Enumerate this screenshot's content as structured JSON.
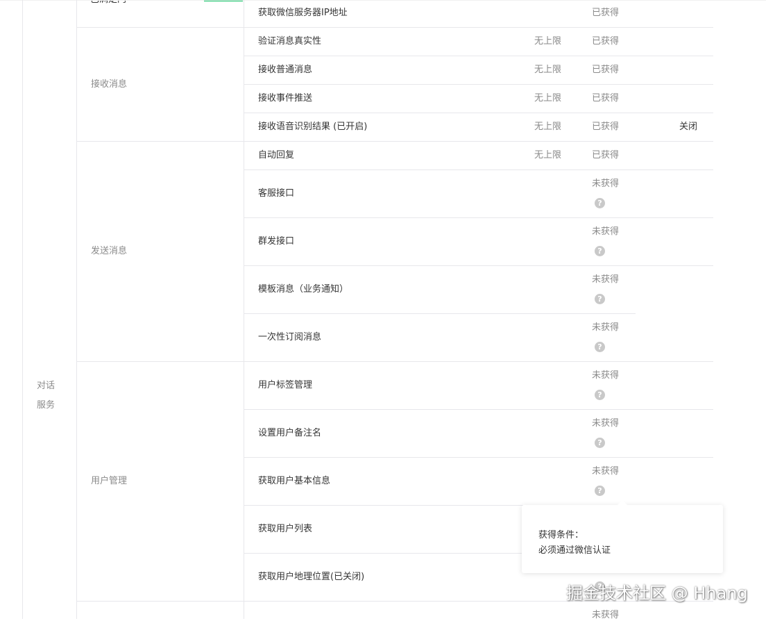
{
  "top_partial_label": "已满足门",
  "category": {
    "line1": "对话",
    "line2": "服务"
  },
  "groups": [
    {
      "label": "接收消息"
    },
    {
      "label": "发送消息"
    },
    {
      "label": "用户管理"
    }
  ],
  "rows": [
    {
      "name": "获取微信服务器IP地址",
      "limit": "",
      "status": "已获得",
      "action": ""
    },
    {
      "name": "验证消息真实性",
      "limit": "无上限",
      "status": "已获得",
      "action": ""
    },
    {
      "name": "接收普通消息",
      "limit": "无上限",
      "status": "已获得",
      "action": ""
    },
    {
      "name": "接收事件推送",
      "limit": "无上限",
      "status": "已获得",
      "action": ""
    },
    {
      "name": "接收语音识别结果 (已开启)",
      "limit": "无上限",
      "status": "已获得",
      "action": "关闭"
    },
    {
      "name": "自动回复",
      "limit": "无上限",
      "status": "已获得",
      "action": ""
    },
    {
      "name": "客服接口",
      "limit": "",
      "status": "未获得",
      "action": ""
    },
    {
      "name": "群发接口",
      "limit": "",
      "status": "未获得",
      "action": ""
    },
    {
      "name": "模板消息（业务通知）",
      "limit": "",
      "status": "未获得",
      "action": ""
    },
    {
      "name": "一次性订阅消息",
      "limit": "",
      "status": "未获得",
      "action": ""
    },
    {
      "name": "用户标签管理",
      "limit": "",
      "status": "未获得",
      "action": ""
    },
    {
      "name": "设置用户备注名",
      "limit": "",
      "status": "未获得",
      "action": ""
    },
    {
      "name": "获取用户基本信息",
      "limit": "",
      "status": "未获得",
      "action": ""
    },
    {
      "name": "获取用户列表",
      "limit": "",
      "status": "",
      "action": ""
    },
    {
      "name": "获取用户地理位置(已关闭)",
      "limit": "",
      "status": "",
      "action": ""
    },
    {
      "name": "",
      "limit": "",
      "status": "未获得",
      "action": ""
    }
  ],
  "popover": {
    "title": "获得条件：",
    "body": "必须通过微信认证"
  },
  "watermark": "掘金技术社区 @ Hhang",
  "colors": {
    "tab_accent": "#07c160",
    "border": "#e7e7eb",
    "help_icon": "#c9c9c9"
  }
}
